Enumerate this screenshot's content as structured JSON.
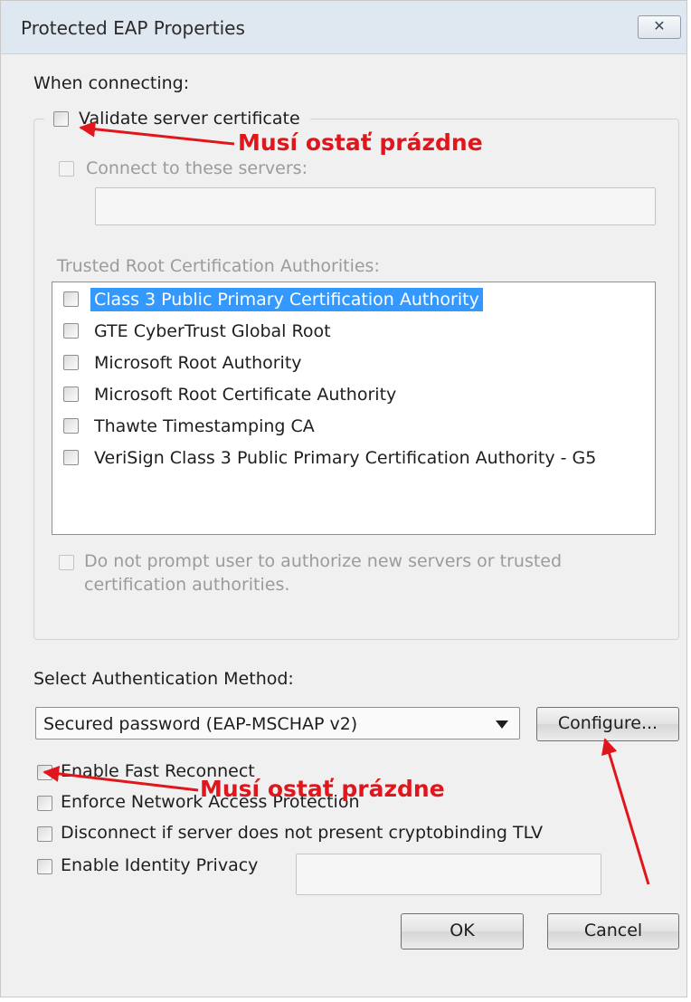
{
  "window": {
    "title": "Protected EAP Properties"
  },
  "section": {
    "when_connecting": "When connecting:"
  },
  "validate": {
    "label": "Validate server certificate",
    "checked": false
  },
  "connect_servers": {
    "label": "Connect to these servers:",
    "checked": false,
    "value": ""
  },
  "trusted_root": {
    "label": "Trusted Root Certification Authorities:",
    "items": [
      {
        "label": "Class 3 Public Primary Certification Authority",
        "checked": false,
        "selected": true
      },
      {
        "label": "GTE CyberTrust Global Root",
        "checked": false
      },
      {
        "label": "Microsoft Root Authority",
        "checked": false
      },
      {
        "label": "Microsoft Root Certificate Authority",
        "checked": false
      },
      {
        "label": "Thawte Timestamping CA",
        "checked": false
      },
      {
        "label": "VeriSign Class 3 Public Primary Certification Authority - G5",
        "checked": false
      }
    ]
  },
  "no_prompt": {
    "line1": "Do not prompt user to authorize new servers or trusted",
    "line2": "certification authorities.",
    "checked": false
  },
  "auth": {
    "label": "Select Authentication Method:",
    "selected": "Secured password (EAP-MSCHAP v2)",
    "configure_label": "Configure..."
  },
  "options": {
    "fast_reconnect": "Enable Fast Reconnect",
    "nap": "Enforce Network Access Protection",
    "cryptobinding": "Disconnect if server does not present cryptobinding TLV",
    "identity_privacy": "Enable Identity Privacy"
  },
  "buttons": {
    "ok": "OK",
    "cancel": "Cancel"
  },
  "annotations": {
    "note1": "Musí ostať prázdne",
    "note2": "Musí ostať prázdne",
    "color": "#e0161c"
  }
}
